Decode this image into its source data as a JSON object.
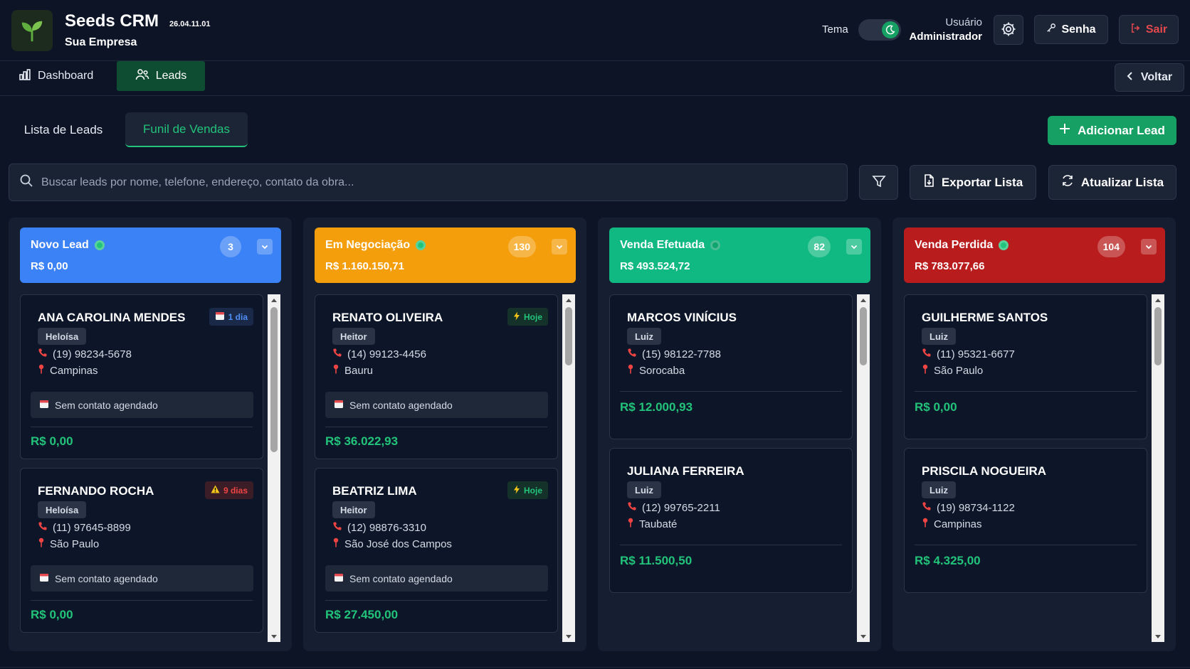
{
  "app": {
    "name": "Seeds CRM",
    "version": "26.04.11.01",
    "company": "Sua Empresa"
  },
  "header": {
    "theme_label": "Tema",
    "user_label": "Usuário",
    "user_role": "Administrador",
    "senha_label": "Senha",
    "sair_label": "Sair"
  },
  "nav": {
    "dashboard": "Dashboard",
    "leads": "Leads",
    "voltar": "Voltar"
  },
  "tabs": {
    "lista": "Lista de Leads",
    "funil": "Funil de Vendas",
    "active": "funil"
  },
  "actions": {
    "add_lead": "Adicionar Lead",
    "search_placeholder": "Buscar leads por nome, telefone, endereço, contato da obra...",
    "search_value": "",
    "export": "Exportar Lista",
    "refresh": "Atualizar Lista"
  },
  "colors": {
    "accent": "#16a063",
    "novo": "#3b82f6",
    "negociacao": "#f59e0b",
    "efetuada": "#10b981",
    "perdida": "#b91c1c"
  },
  "icons": {
    "logo": "sprout-icon",
    "theme": "moon-icon",
    "settings": "gear-icon",
    "password": "key-icon",
    "logout": "logout-icon",
    "dashboard": "bar-chart-icon",
    "leads": "users-icon",
    "back": "chevron-left-icon",
    "add": "plus-icon",
    "search": "search-icon",
    "filter": "filter-icon",
    "export": "file-export-icon",
    "refresh": "refresh-icon",
    "phone": "phone-icon",
    "location": "pin-icon",
    "calendar": "calendar-icon"
  },
  "columns": [
    {
      "title": "Novo Lead",
      "total": "R$ 0,00",
      "count": "3",
      "scroll_fraction": 0.45,
      "cards": [
        {
          "name": "ANA CAROLINA MENDES",
          "badge": "1 dia",
          "badge_type": "blue",
          "owner": "Heloísa",
          "phone": "(19) 98234-5678",
          "city": "Campinas",
          "schedule": "Sem contato agendado",
          "value": "R$ 0,00"
        },
        {
          "name": "FERNANDO ROCHA",
          "badge": "9 dias",
          "badge_type": "red",
          "owner": "Heloísa",
          "phone": "(11) 97645-8899",
          "city": "São Paulo",
          "schedule": "Sem contato agendado",
          "value": "R$ 0,00"
        }
      ]
    },
    {
      "title": "Em Negociação",
      "total": "R$ 1.160.150,71",
      "count": "130",
      "scroll_fraction": 0.18,
      "cards": [
        {
          "name": "RENATO OLIVEIRA",
          "badge": "Hoje",
          "badge_type": "green",
          "owner": "Heitor",
          "phone": "(14) 99123-4456",
          "city": "Bauru",
          "schedule": "Sem contato agendado",
          "value": "R$ 36.022,93"
        },
        {
          "name": "BEATRIZ LIMA",
          "badge": "Hoje",
          "badge_type": "green",
          "owner": "Heitor",
          "phone": "(12) 98876-3310",
          "city": "São José dos Campos",
          "schedule": "Sem contato agendado",
          "value": "R$ 27.450,00"
        }
      ]
    },
    {
      "title": "Venda Efetuada",
      "total": "R$ 493.524,72",
      "count": "82",
      "scroll_fraction": 0.18,
      "cards": [
        {
          "name": "MARCOS VINÍCIUS",
          "badge": "",
          "owner": "Luiz",
          "phone": "(15) 98122-7788",
          "city": "Sorocaba",
          "value": "R$ 12.000,93"
        },
        {
          "name": "JULIANA FERREIRA",
          "badge": "",
          "owner": "Luiz",
          "phone": "(12) 99765-2211",
          "city": "Taubaté",
          "value": "R$ 11.500,50"
        }
      ]
    },
    {
      "title": "Venda Perdida",
      "total": "R$ 783.077,66",
      "count": "104",
      "scroll_fraction": 0.18,
      "cards": [
        {
          "name": "GUILHERME SANTOS",
          "badge": "",
          "owner": "Luiz",
          "phone": "(11) 95321-6677",
          "city": "São Paulo",
          "value": "R$ 0,00"
        },
        {
          "name": "PRISCILA NOGUEIRA",
          "badge": "",
          "owner": "Luiz",
          "phone": "(19) 98734-1122",
          "city": "Campinas",
          "value": "R$ 4.325,00"
        }
      ]
    }
  ]
}
